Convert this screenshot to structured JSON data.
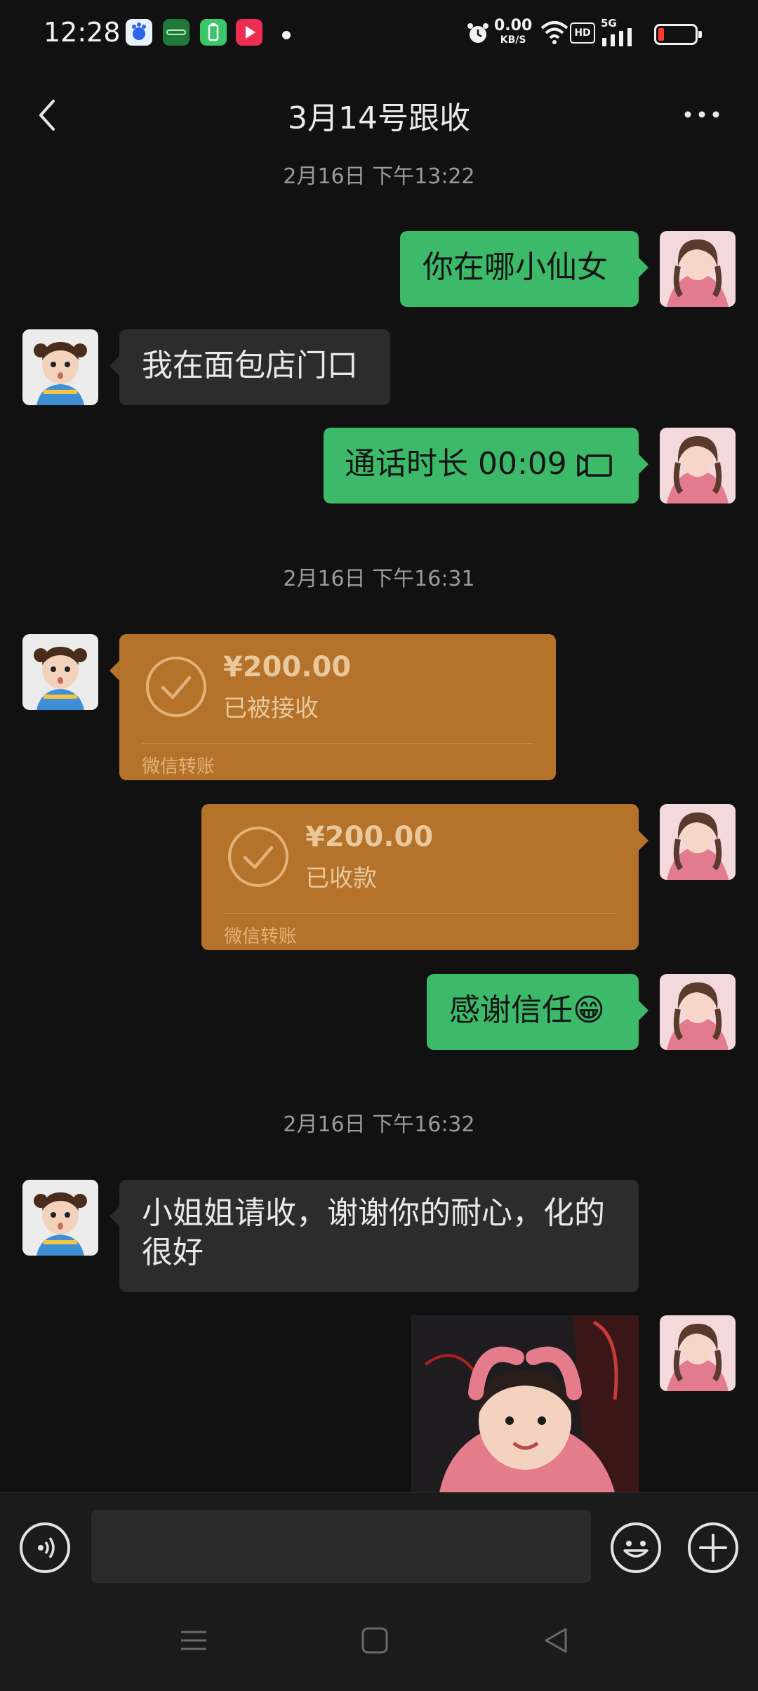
{
  "status_bar": {
    "time": "12:28",
    "net_speed": "0.00",
    "net_unit": "KB/S",
    "hd": "HD",
    "network": "5G",
    "app_icons": [
      "baidu-icon",
      "oppo-icon",
      "battery-saver-icon",
      "video-player-icon"
    ]
  },
  "header": {
    "title": "3月14号跟收"
  },
  "messages": {
    "t1": "2月16日 下午13:22",
    "m1": "你在哪小仙女",
    "m2": "我在面包店门口",
    "m3": "通话时长 00:09",
    "t2": "2月16日 下午16:31",
    "transfer1": {
      "amount": "¥200.00",
      "status": "已被接收",
      "brand": "微信转账"
    },
    "transfer2": {
      "amount": "¥200.00",
      "status": "已收款",
      "brand": "微信转账"
    },
    "m4": "感谢信任😁",
    "t3": "2月16日 下午16:32",
    "m5": "小姐姐请收，谢谢你的耐心，化的很好"
  },
  "colors": {
    "background": "#111111",
    "green_bubble": "#3cba6a",
    "gray_bubble": "#2c2c2c",
    "transfer": "#b5722a"
  },
  "input": {
    "placeholder": ""
  }
}
